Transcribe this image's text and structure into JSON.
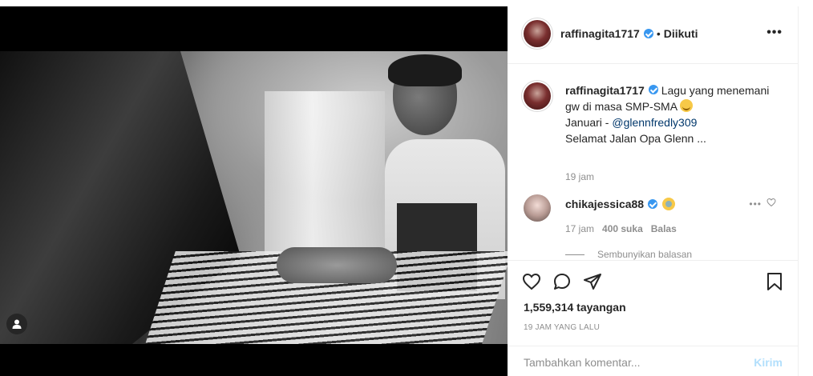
{
  "post": {
    "username": "raffinagita1717",
    "separator": "•",
    "follow_status": "Diikuti",
    "more_label": "•••"
  },
  "caption": {
    "username": "raffinagita1717",
    "text_line1": "Lagu yang menemani gw di masa SMP-SMA",
    "text_line2_prefix": "Januari - ",
    "mention": "@glennfredly309",
    "text_line3": "Selamat Jalan Opa Glenn ...",
    "time": "19 jam"
  },
  "reply": {
    "username": "chikajessica88",
    "time": "17 jam",
    "likes": "400 suka",
    "reply_label": "Balas",
    "more_label": "•••",
    "hide_replies_label": "Sembunyikan balasan"
  },
  "stats": {
    "views": "1,559,314 tayangan",
    "posted_ago": "19 JAM YANG LALU"
  },
  "comment_box": {
    "placeholder": "Tambahkan komentar...",
    "post_label": "Kirim"
  },
  "icons": {
    "verified": "verified-badge-icon",
    "like": "heart-icon",
    "comment": "comment-icon",
    "share": "share-icon",
    "save": "bookmark-icon",
    "user_tag": "user-icon"
  },
  "colors": {
    "verified": "#3897f0",
    "link": "#00376b",
    "muted": "#8e8e8e",
    "post_button_disabled": "#b2dffc"
  }
}
